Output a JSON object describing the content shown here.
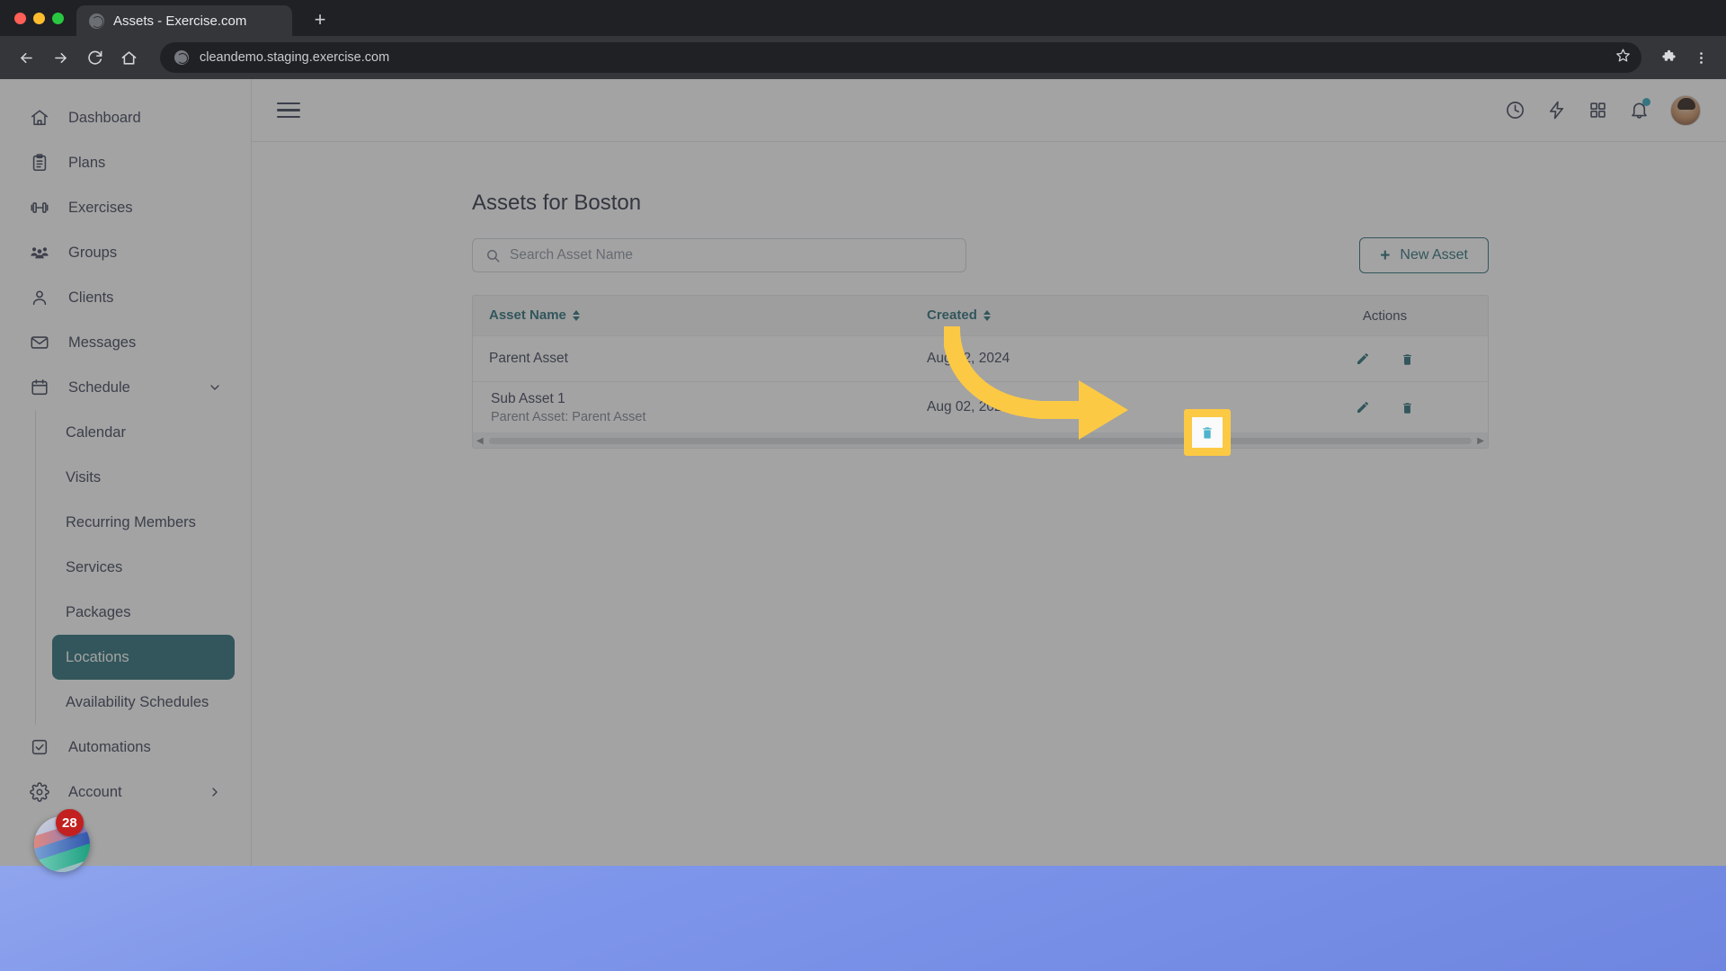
{
  "browser": {
    "tab_title": "Assets - Exercise.com",
    "new_tab_label": "+",
    "url": "cleandemo.staging.exercise.com",
    "back_icon": "back-arrow-icon",
    "forward_icon": "forward-arrow-icon",
    "reload_icon": "reload-icon",
    "home_icon": "home-icon",
    "bookmark_icon": "star-icon",
    "extensions_icon": "puzzle-icon",
    "menu_icon": "three-dot-menu-icon"
  },
  "sidebar": {
    "items": [
      {
        "label": "Dashboard",
        "icon": "home-icon"
      },
      {
        "label": "Plans",
        "icon": "clipboard-icon"
      },
      {
        "label": "Exercises",
        "icon": "dumbbell-icon"
      },
      {
        "label": "Groups",
        "icon": "people-group-icon"
      },
      {
        "label": "Clients",
        "icon": "person-icon"
      },
      {
        "label": "Messages",
        "icon": "envelope-icon"
      },
      {
        "label": "Schedule",
        "icon": "calendar-icon",
        "expanded": true,
        "chevron": "chevron-down-icon"
      }
    ],
    "schedule_children": [
      {
        "label": "Calendar",
        "active": false
      },
      {
        "label": "Visits",
        "active": false
      },
      {
        "label": "Recurring Members",
        "active": false
      },
      {
        "label": "Services",
        "active": false
      },
      {
        "label": "Packages",
        "active": false
      },
      {
        "label": "Locations",
        "active": true
      },
      {
        "label": "Availability Schedules",
        "active": false
      }
    ],
    "items_after": [
      {
        "label": "Automations",
        "icon": "checkbox-icon"
      },
      {
        "label": "Account",
        "icon": "gear-icon",
        "chevron": "chevron-right-icon"
      }
    ],
    "active_color": "#2b6e77"
  },
  "appbar": {
    "menu_toggle": "hamburger-icon",
    "icons": [
      {
        "name": "clock-icon"
      },
      {
        "name": "lightning-bolt-icon"
      },
      {
        "name": "grid-apps-icon"
      },
      {
        "name": "bell-icon",
        "has_dot": true
      }
    ],
    "notification_dot_color": "#2fa8bd",
    "avatar": "user-avatar"
  },
  "main": {
    "title": "Assets for Boston",
    "search": {
      "placeholder": "Search Asset Name",
      "value": "",
      "icon": "search-icon"
    },
    "new_asset_button": {
      "label": "New Asset",
      "plus": "+"
    },
    "table": {
      "columns": [
        {
          "label": "Asset Name",
          "sortable": true
        },
        {
          "label": "Created",
          "sortable": true
        },
        {
          "label": "Actions",
          "sortable": false
        }
      ],
      "rows": [
        {
          "name": "Parent Asset",
          "subtitle": "",
          "created": "Aug 02, 2024",
          "indented": false,
          "actions": [
            "edit-icon",
            "delete-icon"
          ]
        },
        {
          "name": "Sub Asset 1",
          "subtitle": "Parent Asset: Parent Asset",
          "created": "Aug 02, 2024",
          "indented": true,
          "actions": [
            "edit-icon",
            "delete-icon"
          ]
        }
      ],
      "horizontal_scrollbar": true
    }
  },
  "overlay": {
    "highlight_target": "delete-icon-sub-asset-1",
    "highlight_color": "#fbc944",
    "arrow_color": "#fbc944",
    "dim": true
  },
  "dock": {
    "app_badge_count": "28",
    "badge_color": "#c32020"
  }
}
